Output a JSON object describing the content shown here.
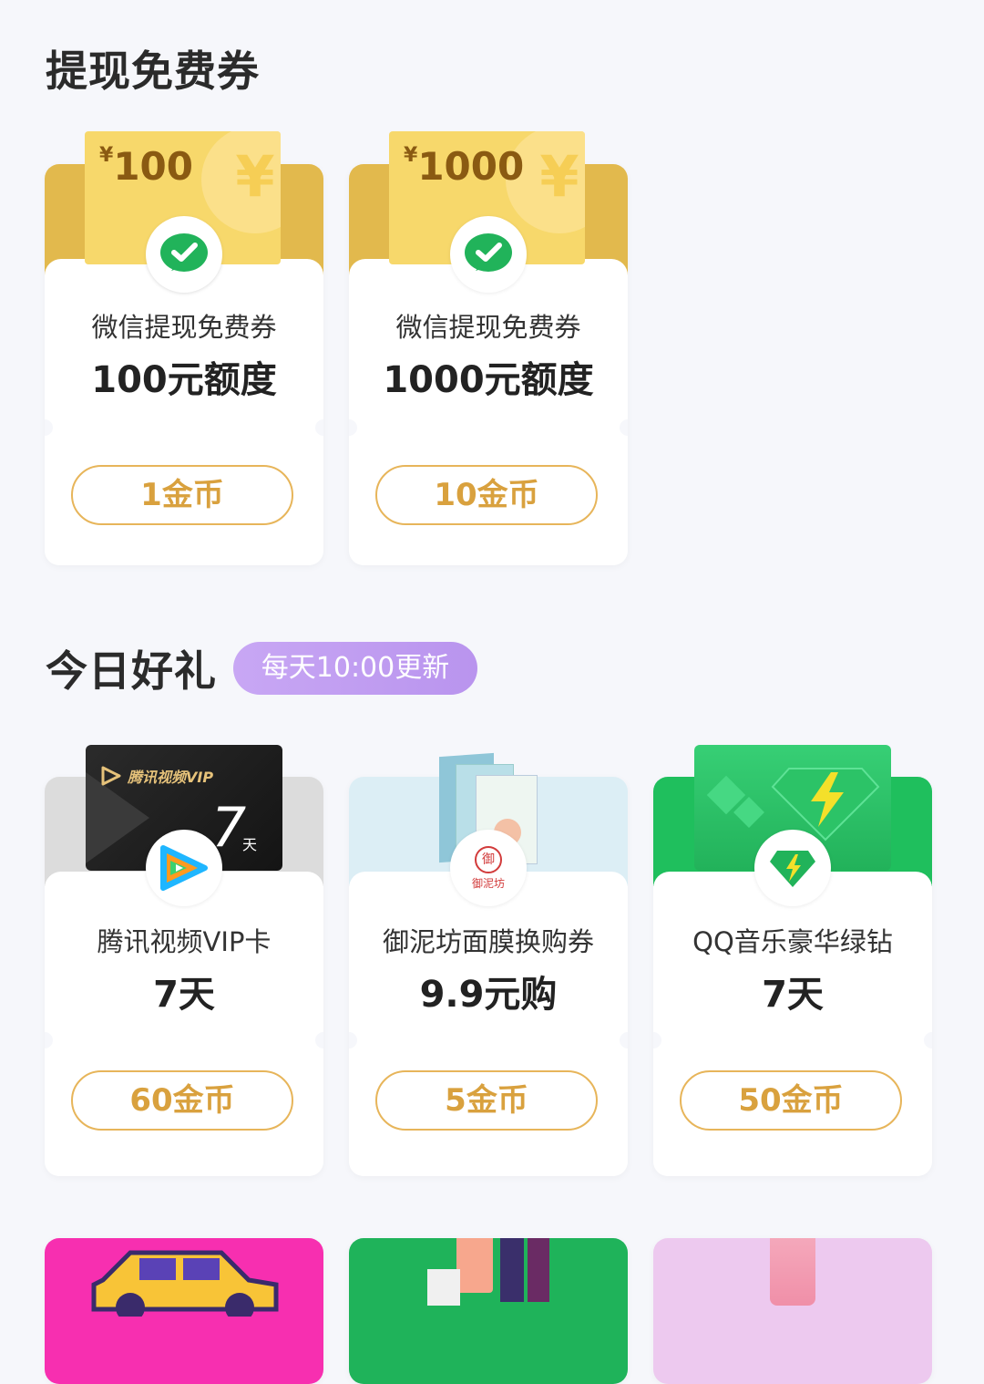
{
  "section_withdraw": {
    "title": "提现免费券"
  },
  "coupons": [
    {
      "amount": "100",
      "currency": "¥",
      "name": "微信提现免费券",
      "value": "100元额度",
      "price": "1金币"
    },
    {
      "amount": "1000",
      "currency": "¥",
      "name": "微信提现免费券",
      "value": "1000元额度",
      "price": "10金币"
    }
  ],
  "section_daily": {
    "title": "今日好礼",
    "update_note": "每天10:00更新"
  },
  "gifts": [
    {
      "name": "腾讯视频VIP卡",
      "value": "7天",
      "price": "60金币",
      "card_brand": "腾讯视频VIP",
      "card_days": "7",
      "card_days_unit": "天"
    },
    {
      "name": "御泥坊面膜换购券",
      "value": "9.9元购",
      "price": "5金币",
      "logo_text": "御泥坊"
    },
    {
      "name": "QQ音乐豪华绿钻",
      "value": "7天",
      "price": "50金币"
    }
  ],
  "colors": {
    "gold": "#e2b94d",
    "accent_price": "#d9a13e",
    "purple_pill": "#c8a7f4",
    "green": "#21b35a"
  }
}
